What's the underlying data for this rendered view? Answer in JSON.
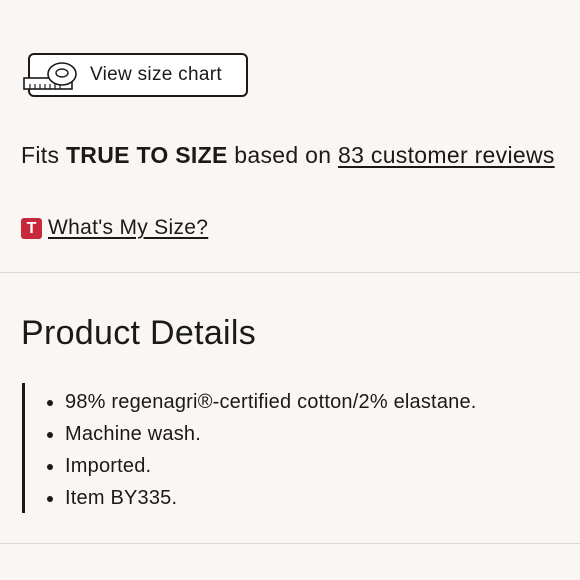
{
  "size_chart": {
    "label": "View size chart",
    "icon": "measuring-tape-icon"
  },
  "fit": {
    "prefix": "Fits",
    "emphasis": "TRUE TO SIZE",
    "middle": "based on",
    "reviews_link": "83 customer reviews"
  },
  "whats_my_size": {
    "badge": "T",
    "link": "What's My Size?",
    "badge_color": "#c8283c"
  },
  "product_details": {
    "title": "Product Details",
    "items": [
      "98% regenagri®-certified cotton/2% elastane.",
      "Machine wash.",
      "Imported.",
      "Item BY335."
    ]
  }
}
